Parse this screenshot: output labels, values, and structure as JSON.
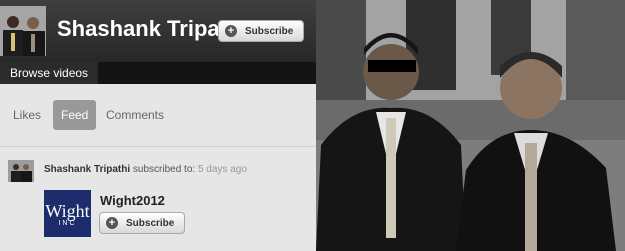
{
  "channel": {
    "name": "Shashank Tripathi",
    "subscribe_label": "Subscribe"
  },
  "nav": {
    "browse_label": "Browse videos"
  },
  "tabs": [
    {
      "label": "Likes"
    },
    {
      "label": "Feed"
    },
    {
      "label": "Comments"
    }
  ],
  "feed": {
    "user": "Shashank Tripathi",
    "action": "subscribed to:",
    "time": "5 days ago",
    "item": {
      "logo_text": "Wight",
      "logo_sub": "INC",
      "title": "Wight2012",
      "subscribe_label": "Subscribe"
    }
  }
}
